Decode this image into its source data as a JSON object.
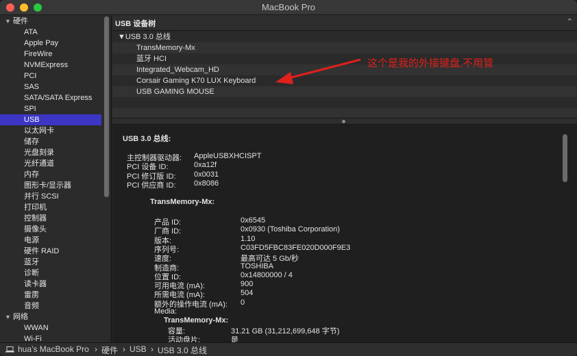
{
  "window": {
    "title": "MacBook Pro"
  },
  "sidebar": {
    "items": [
      {
        "label": "硬件",
        "type": "group"
      },
      {
        "label": "ATA",
        "type": "child"
      },
      {
        "label": "Apple Pay",
        "type": "child"
      },
      {
        "label": "FireWire",
        "type": "child"
      },
      {
        "label": "NVMExpress",
        "type": "child"
      },
      {
        "label": "PCI",
        "type": "child"
      },
      {
        "label": "SAS",
        "type": "child"
      },
      {
        "label": "SATA/SATA Express",
        "type": "child"
      },
      {
        "label": "SPI",
        "type": "child"
      },
      {
        "label": "USB",
        "type": "child",
        "selected": true
      },
      {
        "label": "以太网卡",
        "type": "child"
      },
      {
        "label": "储存",
        "type": "child"
      },
      {
        "label": "光盘刻录",
        "type": "child"
      },
      {
        "label": "光纤通道",
        "type": "child"
      },
      {
        "label": "内存",
        "type": "child"
      },
      {
        "label": "图形卡/显示器",
        "type": "child"
      },
      {
        "label": "并行 SCSI",
        "type": "child"
      },
      {
        "label": "打印机",
        "type": "child"
      },
      {
        "label": "控制器",
        "type": "child"
      },
      {
        "label": "摄像头",
        "type": "child"
      },
      {
        "label": "电源",
        "type": "child"
      },
      {
        "label": "硬件 RAID",
        "type": "child"
      },
      {
        "label": "蓝牙",
        "type": "child"
      },
      {
        "label": "诊断",
        "type": "child"
      },
      {
        "label": "读卡器",
        "type": "child"
      },
      {
        "label": "雷雳",
        "type": "child"
      },
      {
        "label": "音频",
        "type": "child"
      },
      {
        "label": "网络",
        "type": "group"
      },
      {
        "label": "WWAN",
        "type": "child"
      },
      {
        "label": "Wi-Fi",
        "type": "child"
      }
    ]
  },
  "tree": {
    "header": "USB 设备树",
    "root": "▼USB 3.0 总线",
    "devices": [
      "TransMemory-Mx",
      "蓝牙 HCI",
      "Integrated_Webcam_HD",
      "Corsair Gaming K70 LUX Keyboard",
      "USB GAMING MOUSE"
    ]
  },
  "annotation": {
    "text": "这个是我的外接键盘,不用管",
    "color": "#e0201b"
  },
  "detail": {
    "bus_title": "USB 3.0 总线:",
    "bus_props": [
      {
        "key": "主控制器驱动器:",
        "value": "AppleUSBXHCISPT"
      },
      {
        "key": "PCI 设备 ID:",
        "value": "0xa12f"
      },
      {
        "key": "PCI 修订版 ID:",
        "value": "0x0031"
      },
      {
        "key": "PCI 供应商 ID:",
        "value": "0x8086"
      }
    ],
    "device_title": "TransMemory-Mx:",
    "device_props": [
      {
        "key": "产品 ID:",
        "value": "0x6545"
      },
      {
        "key": "厂商 ID:",
        "value": "0x0930  (Toshiba Corporation)"
      },
      {
        "key": "版本:",
        "value": "1.10"
      },
      {
        "key": "序列号:",
        "value": "C03FD5FBC83FE020D000F9E3"
      },
      {
        "key": "速度:",
        "value": "最高可达 5 Gb/秒"
      },
      {
        "key": "制造商:",
        "value": "TOSHIBA"
      },
      {
        "key": "位置 ID:",
        "value": "0x14800000 / 4"
      },
      {
        "key": "可用电流 (mA):",
        "value": "900"
      },
      {
        "key": "所需电流 (mA):",
        "value": "504"
      },
      {
        "key": "额外的操作电流 (mA):",
        "value": "0"
      }
    ],
    "media_label": "Media:",
    "media_title": "TransMemory-Mx:",
    "media_props": [
      {
        "key": "容量:",
        "value": "31.21 GB  (31,212,699,648 字节)"
      },
      {
        "key": "活动盘片:",
        "value": "是"
      }
    ]
  },
  "pathbar": {
    "segments": [
      "hua’s MacBook Pro",
      "硬件",
      "USB",
      "USB 3.0 总线"
    ],
    "separator": "›"
  },
  "icons": {
    "disclosure": "disclosure-triangle-icon",
    "laptop": "laptop-icon",
    "collapse": "chevron-up-icon"
  }
}
